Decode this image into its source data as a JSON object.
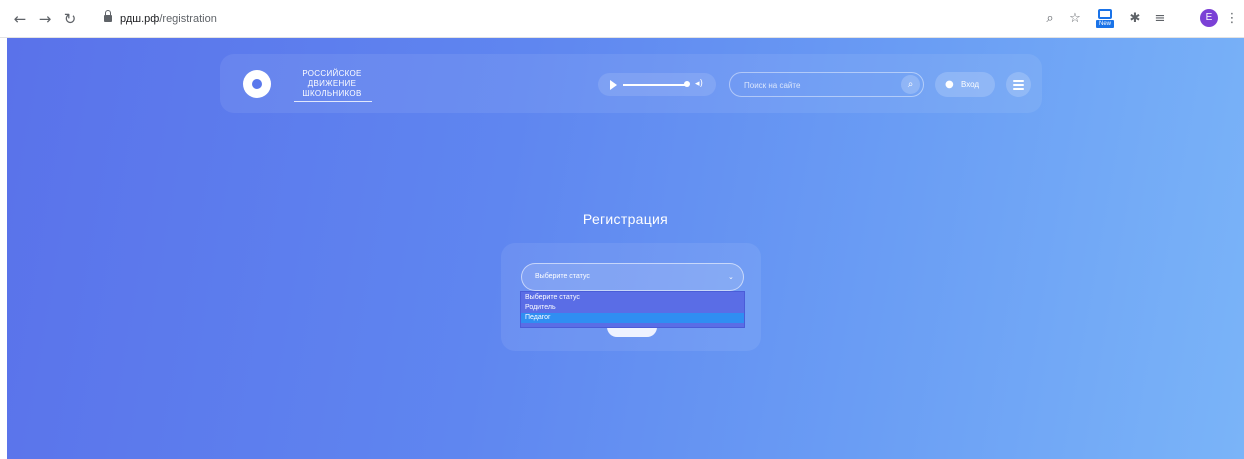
{
  "browser": {
    "url_host": "рдш.рф",
    "url_path": "/registration",
    "avatar_letter": "E",
    "ext_new_badge": "New",
    "icons": [
      "back-icon",
      "forward-icon",
      "reload-icon",
      "lock-icon",
      "zoom-icon",
      "star-icon",
      "extension-new-icon",
      "puzzle-icon",
      "reading-list-icon",
      "profile-avatar",
      "kebab-menu-icon"
    ]
  },
  "header": {
    "logo_line1": "РОССИЙСКОЕ",
    "logo_line2": "ДВИЖЕНИЕ ШКОЛЬНИКОВ",
    "search_placeholder": "Поиск на сайте",
    "login_label": "Вход"
  },
  "main": {
    "title": "Регистрация",
    "select_value": "Выберите статус",
    "options": [
      "Выберите статус",
      "Родитель",
      "Педагог"
    ],
    "selected_option_index": 2
  },
  "colors": {
    "bg_start": "#5a72ea",
    "bg_end": "#7ab4f8",
    "dropdown_bg": "#5a6de6",
    "option_highlight": "#2f8ef2"
  }
}
